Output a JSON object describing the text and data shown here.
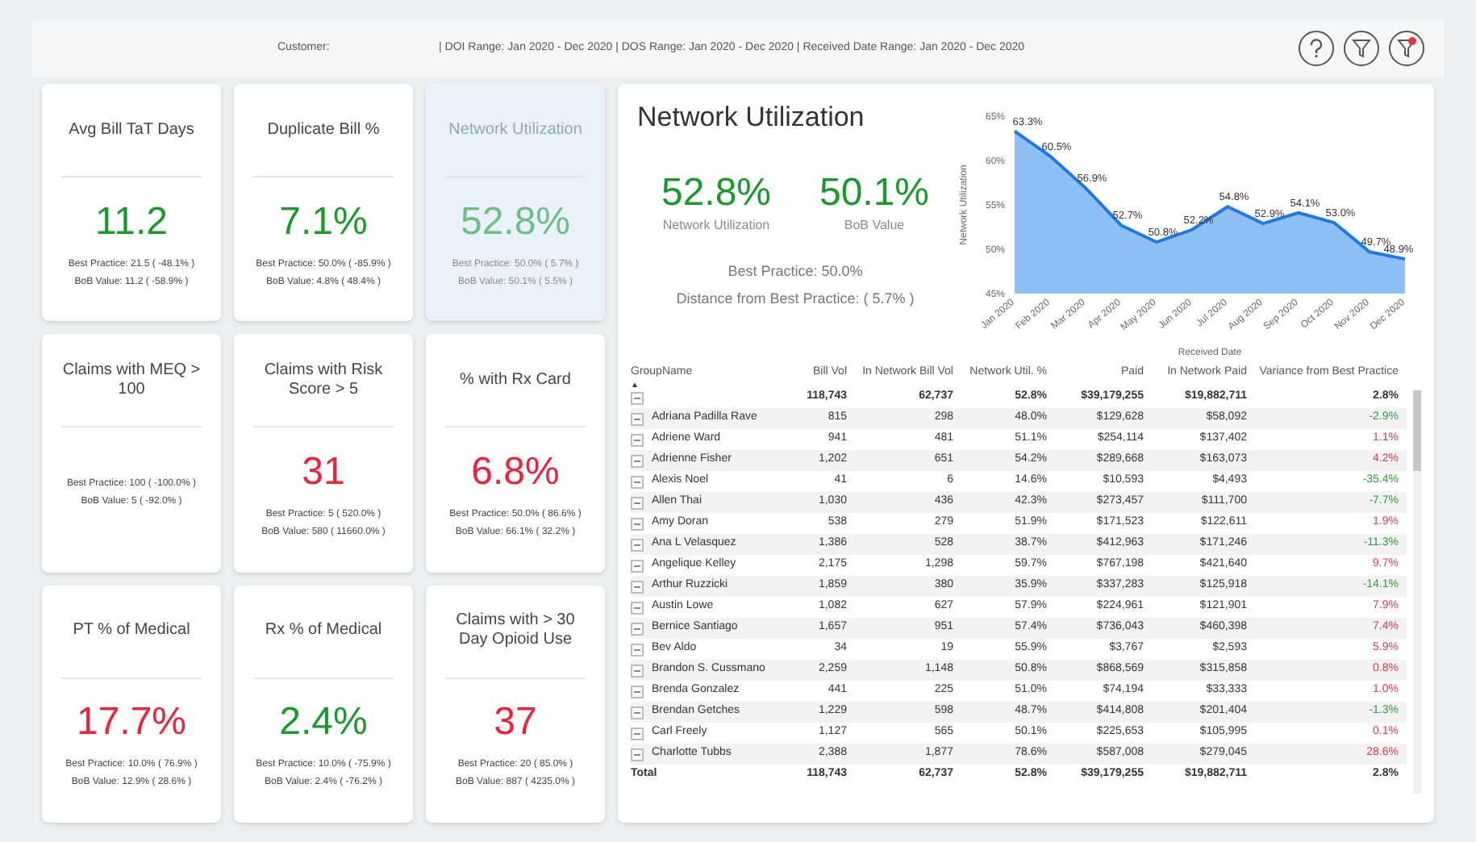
{
  "header": {
    "customer_label": "Customer:",
    "date_ranges": "| DOI Range: Jan 2020 - Dec 2020 | DOS Range: Jan 2020 - Dec 2020 | Received Date Range: Jan 2020 - Dec 2020",
    "filter_active": true
  },
  "cards": [
    {
      "title": "Avg Bill TaT Days",
      "value": "11.2",
      "color": "#1a9a2a",
      "selected": false,
      "best_practice": "Best Practice: 21.5 ( -48.1% )",
      "bob_value": "BoB Value: 11.2 ( -58.9% )"
    },
    {
      "title": "Duplicate Bill %",
      "value": "7.1%",
      "color": "#1a9a2a",
      "selected": false,
      "best_practice": "Best Practice: 50.0% ( -85.9% )",
      "bob_value": "BoB Value: 4.8% ( 48.4% )"
    },
    {
      "title": "Network Utilization",
      "value": "52.8%",
      "color": "#6cbf8a",
      "selected": true,
      "best_practice": "Best Practice: 50.0% ( 5.7% )",
      "bob_value": "BoB Value: 50.1% ( 5.5% )"
    },
    {
      "title": "Claims with MEQ > 100",
      "selected": false,
      "best_practice": "Best Practice: 100 ( -100.0% )",
      "bob_value": "BoB Value: 5 ( -92.0% )"
    },
    {
      "title": "Claims with Risk Score > 5",
      "value": "31",
      "color": "#f0213c",
      "selected": false,
      "best_practice": "Best Practice: 5 ( 520.0% )",
      "bob_value": "BoB Value: 580 ( 11660.0% )"
    },
    {
      "title": "% with Rx Card",
      "value": "6.8%",
      "color": "#f0213c",
      "selected": false,
      "best_practice": "Best Practice: 50.0% ( 86.6% )",
      "bob_value": "BoB Value: 66.1% ( 32.2% )"
    },
    {
      "title": "PT % of Medical",
      "value": "17.7%",
      "color": "#f0213c",
      "selected": false,
      "best_practice": "Best Practice: 10.0% ( 76.9% )",
      "bob_value": "BoB Value: 12.9% ( 28.6% )"
    },
    {
      "title": "Rx % of Medical",
      "value": "2.4%",
      "color": "#1a9a2a",
      "selected": false,
      "best_practice": "Best Practice: 10.0% ( -75.9% )",
      "bob_value": "BoB Value: 2.4% ( -76.2% )"
    },
    {
      "title": "Claims with > 30 Day Opioid Use",
      "value": "37",
      "color": "#f0213c",
      "selected": false,
      "best_practice": "Best Practice: 20 ( 85.0% )",
      "bob_value": "BoB Value: 887 ( 4235.0% )"
    }
  ],
  "detail": {
    "title": "Network Utilization",
    "metrics": [
      {
        "value": "52.8%",
        "label": "Network Utilization"
      },
      {
        "value": "50.1%",
        "label": "BoB Value"
      }
    ],
    "best_practice": "Best Practice: 50.0%",
    "distance": "Distance from Best Practice: ( 5.7% )",
    "chart_data": {
      "type": "area",
      "xlabel": "Received Date",
      "ylabel": "Network Utilization",
      "categories": [
        "Jan 2020",
        "Feb 2020",
        "Mar 2020",
        "Apr 2020",
        "May 2020",
        "Jun 2020",
        "Jul 2020",
        "Aug 2020",
        "Sep 2020",
        "Oct 2020",
        "Nov 2020",
        "Dec 2020"
      ],
      "series": [
        {
          "color": "#1e78e6",
          "values": [
            63.3,
            60.5,
            56.9,
            52.7,
            50.8,
            52.2,
            54.8,
            52.9,
            54.1,
            53.0,
            49.7,
            48.9
          ]
        }
      ],
      "ylim": [
        45,
        65
      ],
      "yticks": [
        {
          "value": 45,
          "label": "45%"
        },
        {
          "value": 50,
          "label": "50%"
        },
        {
          "value": 55,
          "label": "55%"
        },
        {
          "value": 60,
          "label": "60%"
        },
        {
          "value": 65,
          "label": "65%"
        }
      ],
      "value_labels": [
        "63.3%",
        "60.5%",
        "56.9%",
        "52.7%",
        "50.8%",
        "52.2%",
        "54.8%",
        "52.9%",
        "54.1%",
        "53.0%",
        "49.7%",
        "48.9%"
      ]
    }
  },
  "table": {
    "columns": [
      "GroupName",
      "Bill Vol",
      "In Network Bill Vol",
      "Network Util. %",
      "Paid",
      "In Network Paid",
      "Variance from Best Practice"
    ],
    "sort_indicator": "▲",
    "summary": [
      "118,743",
      "62,737",
      "52.8%",
      "$39,179,255",
      "$19,882,711",
      "2.8%"
    ],
    "rows": [
      {
        "cells": [
          "Adriana Padilla Rave",
          "815",
          "298",
          "48.0%",
          "$129,628",
          "$58,092",
          "-2.9%"
        ],
        "color": "#2a9a3a"
      },
      {
        "cells": [
          "Adriene Ward",
          "941",
          "481",
          "51.1%",
          "$254,114",
          "$137,402",
          "1.1%"
        ],
        "color": "#e8344a"
      },
      {
        "cells": [
          "Adrienne Fisher",
          "1,202",
          "651",
          "54.2%",
          "$289,668",
          "$163,073",
          "4.2%"
        ],
        "color": "#e8344a"
      },
      {
        "cells": [
          "Alexis Noel",
          "41",
          "6",
          "14.6%",
          "$10,593",
          "$4,493",
          "-35.4%"
        ],
        "color": "#2a9a3a"
      },
      {
        "cells": [
          "Allen Thai",
          "1,030",
          "436",
          "42.3%",
          "$273,457",
          "$111,700",
          "-7.7%"
        ],
        "color": "#2a9a3a"
      },
      {
        "cells": [
          "Amy Doran",
          "538",
          "279",
          "51.9%",
          "$171,523",
          "$122,611",
          "1.9%"
        ],
        "color": "#e8344a"
      },
      {
        "cells": [
          "Ana L Velasquez",
          "1,386",
          "528",
          "38.7%",
          "$412,963",
          "$171,246",
          "-11.3%"
        ],
        "color": "#2a9a3a"
      },
      {
        "cells": [
          "Angelique Kelley",
          "2,175",
          "1,298",
          "59.7%",
          "$767,198",
          "$421,640",
          "9.7%"
        ],
        "color": "#e8344a"
      },
      {
        "cells": [
          "Arthur Ruzzicki",
          "1,859",
          "380",
          "35.9%",
          "$337,283",
          "$125,918",
          "-14.1%"
        ],
        "color": "#2a9a3a"
      },
      {
        "cells": [
          "Austin Lowe",
          "1,082",
          "627",
          "57.9%",
          "$224,961",
          "$121,901",
          "7.9%"
        ],
        "color": "#e8344a"
      },
      {
        "cells": [
          "Bernice Santiago",
          "1,657",
          "951",
          "57.4%",
          "$736,043",
          "$460,398",
          "7.4%"
        ],
        "color": "#e8344a"
      },
      {
        "cells": [
          "Bev Aldo",
          "34",
          "19",
          "55.9%",
          "$3,767",
          "$2,593",
          "5.9%"
        ],
        "color": "#e8344a"
      },
      {
        "cells": [
          "Brandon S. Cussmano",
          "2,259",
          "1,148",
          "50.8%",
          "$868,569",
          "$315,858",
          "0.8%"
        ],
        "color": "#e8344a"
      },
      {
        "cells": [
          "Brenda Gonzalez",
          "441",
          "225",
          "51.0%",
          "$74,194",
          "$33,333",
          "1.0%"
        ],
        "color": "#e8344a"
      },
      {
        "cells": [
          "Brendan Getches",
          "1,229",
          "598",
          "48.7%",
          "$414,808",
          "$201,404",
          "-1.3%"
        ],
        "color": "#2a9a3a"
      },
      {
        "cells": [
          "Carl Freely",
          "1,127",
          "565",
          "50.1%",
          "$225,653",
          "$105,995",
          "0.1%"
        ],
        "color": "#e8344a"
      },
      {
        "cells": [
          "Charlotte Tubbs",
          "2,388",
          "1,877",
          "78.6%",
          "$587,008",
          "$279,045",
          "28.6%"
        ],
        "color": "#e8344a"
      }
    ],
    "total": [
      "Total",
      "118,743",
      "62,737",
      "52.8%",
      "$39,179,255",
      "$19,882,711",
      "2.8%"
    ]
  }
}
